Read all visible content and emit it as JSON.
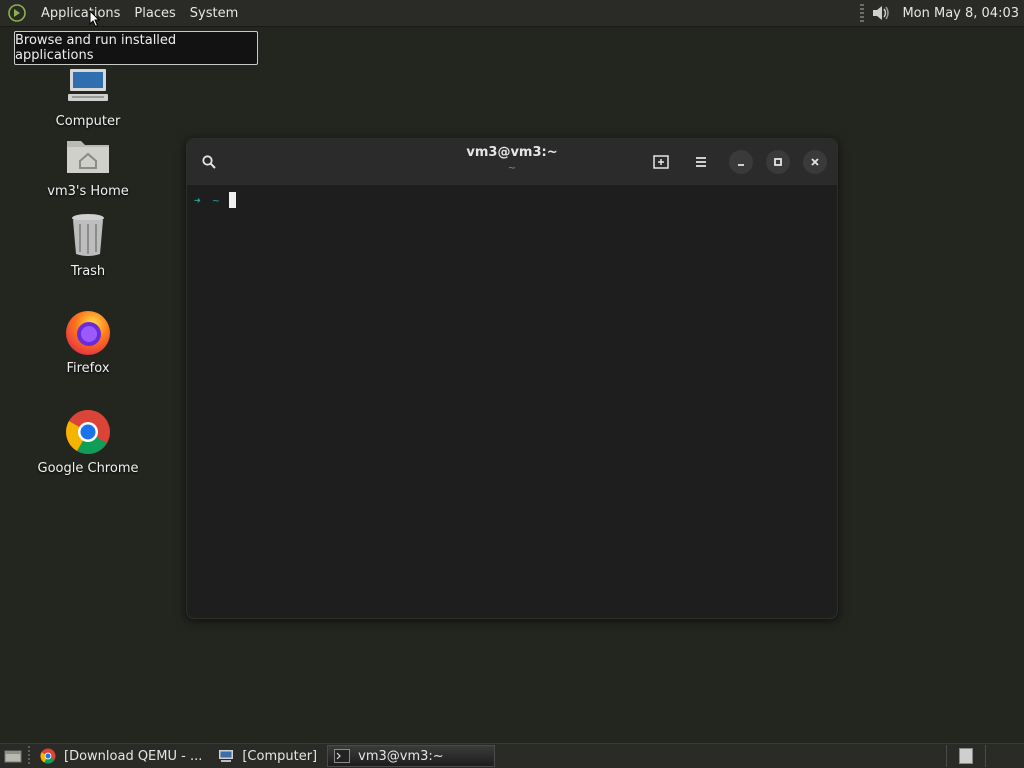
{
  "top_panel": {
    "menus": [
      "Applications",
      "Places",
      "System"
    ],
    "clock": "Mon May  8, 04:03"
  },
  "tooltip": {
    "text": "Browse and run installed applications"
  },
  "desktop": {
    "icons": [
      {
        "label": "Computer",
        "icon": "computer-icon"
      },
      {
        "label": "vm3's Home",
        "icon": "home-folder-icon"
      },
      {
        "label": "Trash",
        "icon": "trash-icon"
      },
      {
        "label": "Firefox",
        "icon": "firefox-icon"
      },
      {
        "label": "Google Chrome",
        "icon": "chrome-icon"
      }
    ]
  },
  "terminal": {
    "title": "vm3@vm3:~",
    "subtitle": "~",
    "prompt_arrow": "➜",
    "prompt_dir": "~"
  },
  "taskbar": {
    "tasks": [
      {
        "label": "[Download QEMU - ...",
        "icon": "chrome-icon",
        "active": false
      },
      {
        "label": "[Computer]",
        "icon": "computer-icon",
        "active": false
      },
      {
        "label": "vm3@vm3:~",
        "icon": "terminal-icon",
        "active": true
      }
    ]
  },
  "colors": {
    "desktop_bg": "#23251f",
    "panel_bg": "#2a2b27",
    "terminal_bg": "#1e1e1e",
    "prompt_accent": "#26a69a"
  }
}
